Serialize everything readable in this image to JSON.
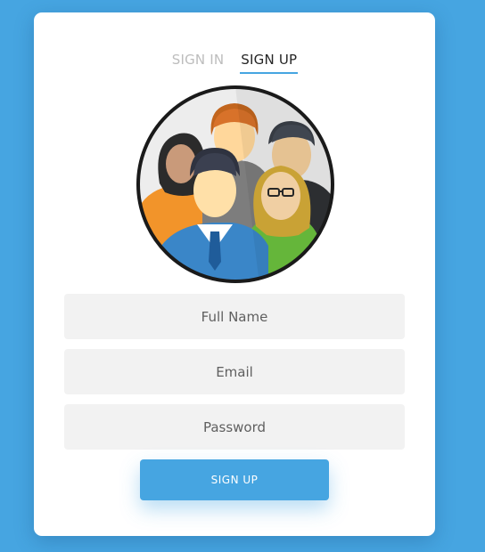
{
  "tabs": {
    "sign_in": "SIGN IN",
    "sign_up": "SIGN UP",
    "active": "sign_up"
  },
  "avatar": {
    "icon": "group-of-users-icon"
  },
  "form": {
    "full_name": {
      "placeholder": "Full Name",
      "value": ""
    },
    "email": {
      "placeholder": "Email",
      "value": ""
    },
    "password": {
      "placeholder": "Password",
      "value": ""
    },
    "submit_label": "SIGN UP"
  },
  "colors": {
    "background": "#46a5e1",
    "card": "#ffffff",
    "accent": "#46a5e1",
    "field_bg": "#f2f2f2"
  }
}
